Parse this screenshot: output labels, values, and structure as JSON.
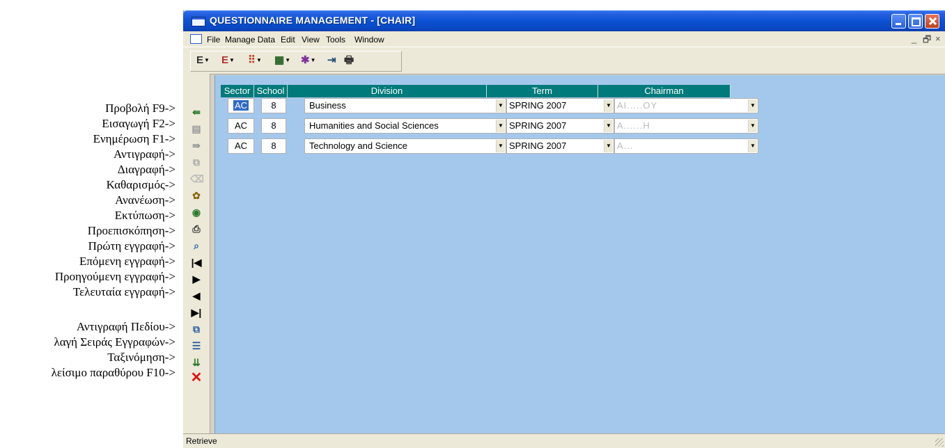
{
  "annotations": [
    "Προβολή F9->",
    "Εισαγωγή F2->",
    "Ενημέρωση F1->",
    "Αντιγραφή->",
    "Διαγραφή->",
    "Καθαρισμός->",
    "Ανανέωση->",
    "Εκτύπωση->",
    "Προεπισκόπηση->",
    "Πρώτη εγγραφή->",
    "Επόμενη εγγραφή->",
    "Προηγούμενη εγγραφή->",
    "Τελευταία εγγραφή->",
    "Αντιγραφή Πεδίου->",
    "λαγή Σειράς Εγγραφών->",
    "Ταξινόμηση->",
    "λείσιμο παραθύρου F10->"
  ],
  "window": {
    "title": "QUESTIONNAIRE MANAGEMENT - [CHAIR]"
  },
  "menu": [
    "File",
    "Manage Data",
    "Edit",
    "View",
    "Tools",
    "Window"
  ],
  "mdi_controls": {
    "minimize": "_",
    "restore": "🗗",
    "close": "×"
  },
  "toolbar": [
    "E",
    "E",
    "⠿",
    "▦",
    "✱",
    "⇥",
    "🖶"
  ],
  "vtoolbar_icons": [
    "retrieve-icon",
    "insert-icon",
    "update-icon",
    "copy-icon",
    "delete-icon",
    "clear-icon",
    "refresh-icon",
    "print-icon",
    "preview-icon",
    "first-record-icon",
    "next-record-icon",
    "previous-record-icon",
    "last-record-icon",
    "copy-field-icon",
    "change-order-icon",
    "sort-icon",
    "close-window-icon"
  ],
  "grid": {
    "headers": [
      "Sector",
      "School",
      "Division",
      "Term",
      "Chairman"
    ],
    "rows": [
      {
        "sector": "AC",
        "school": "8",
        "division": "Business",
        "term": "SPRING 2007",
        "chairman": "AI.....OY"
      },
      {
        "sector": "AC",
        "school": "8",
        "division": "Humanities and Social Sciences",
        "term": "SPRING 2007",
        "chairman": "A......H"
      },
      {
        "sector": "AC",
        "school": "8",
        "division": "Technology and Science",
        "term": "SPRING 2007",
        "chairman": "A..."
      }
    ]
  },
  "status": {
    "text": "Retrieve"
  },
  "colors": {
    "header": "#007a7a",
    "client": "#a4c8ec",
    "titlebar": "#0b52d4"
  }
}
